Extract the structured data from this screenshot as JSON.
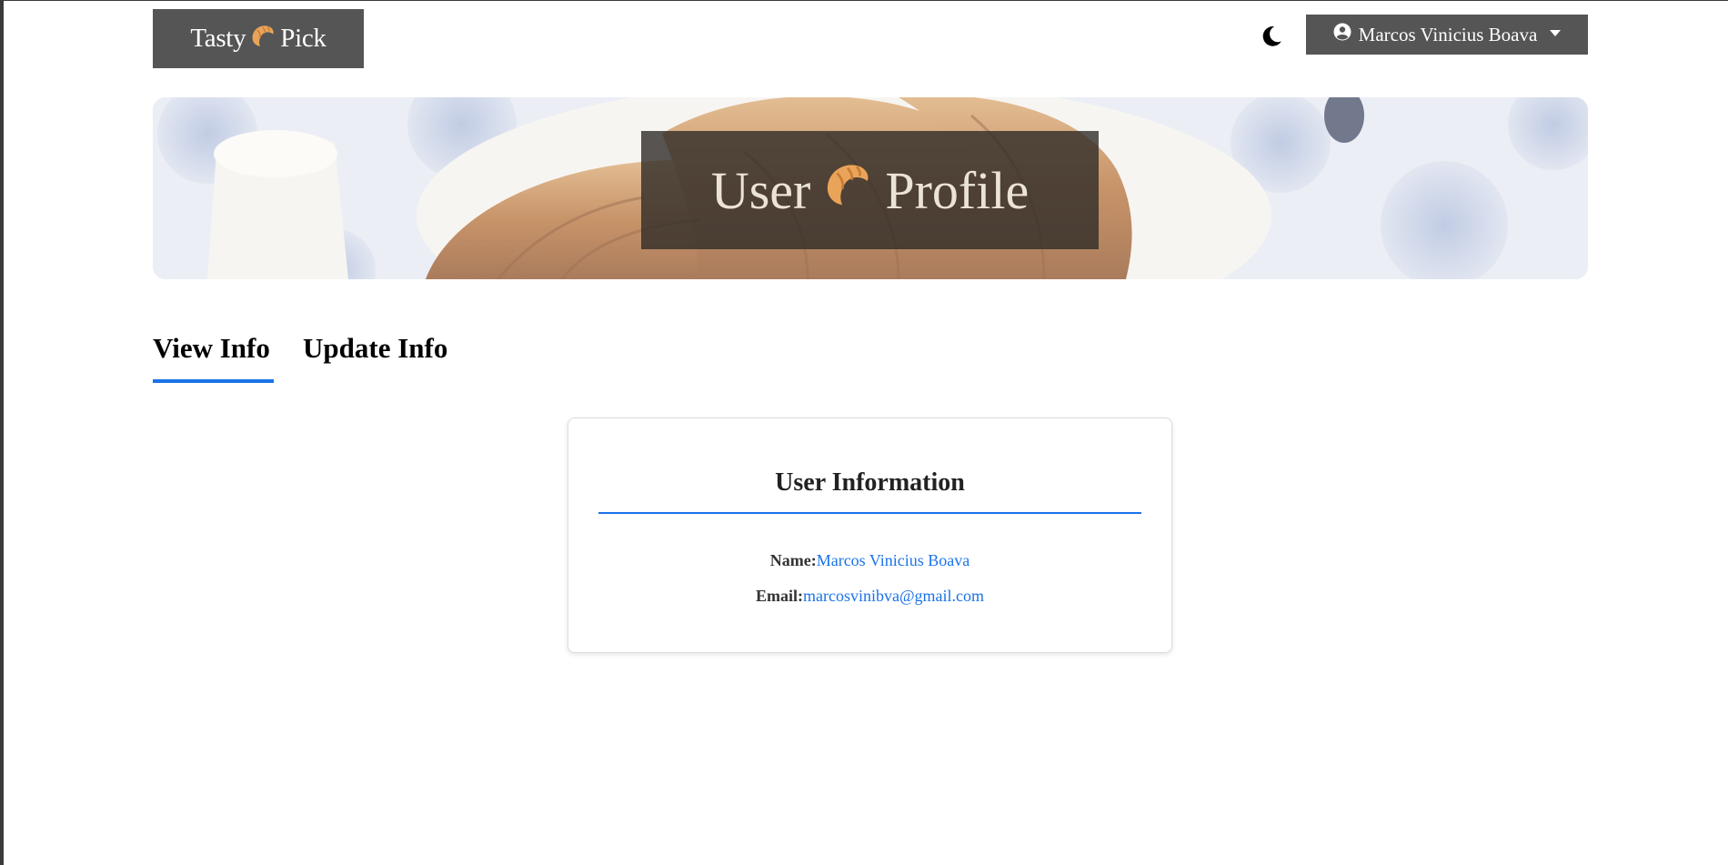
{
  "navbar": {
    "brand_left": "Tasty",
    "brand_right": "Pick",
    "brand_icon": "croissant-icon",
    "theme_icon": "moon-icon",
    "user_icon": "user-circle-icon",
    "user_name": "Marcos Vinicius Boava"
  },
  "hero": {
    "title_left": "User",
    "title_right": "Profile",
    "title_icon": "croissant-icon"
  },
  "tabs": [
    {
      "label": "View Info",
      "active": true
    },
    {
      "label": "Update Info",
      "active": false
    }
  ],
  "card": {
    "title": "User Information",
    "name_label": "Name:",
    "name_value": "Marcos Vinicius Boava",
    "email_label": "Email:",
    "email_value": "marcosvinibva@gmail.com"
  },
  "colors": {
    "accent": "#1a73e8",
    "nav_bg": "#555555",
    "croissant": "#e9a45a"
  }
}
